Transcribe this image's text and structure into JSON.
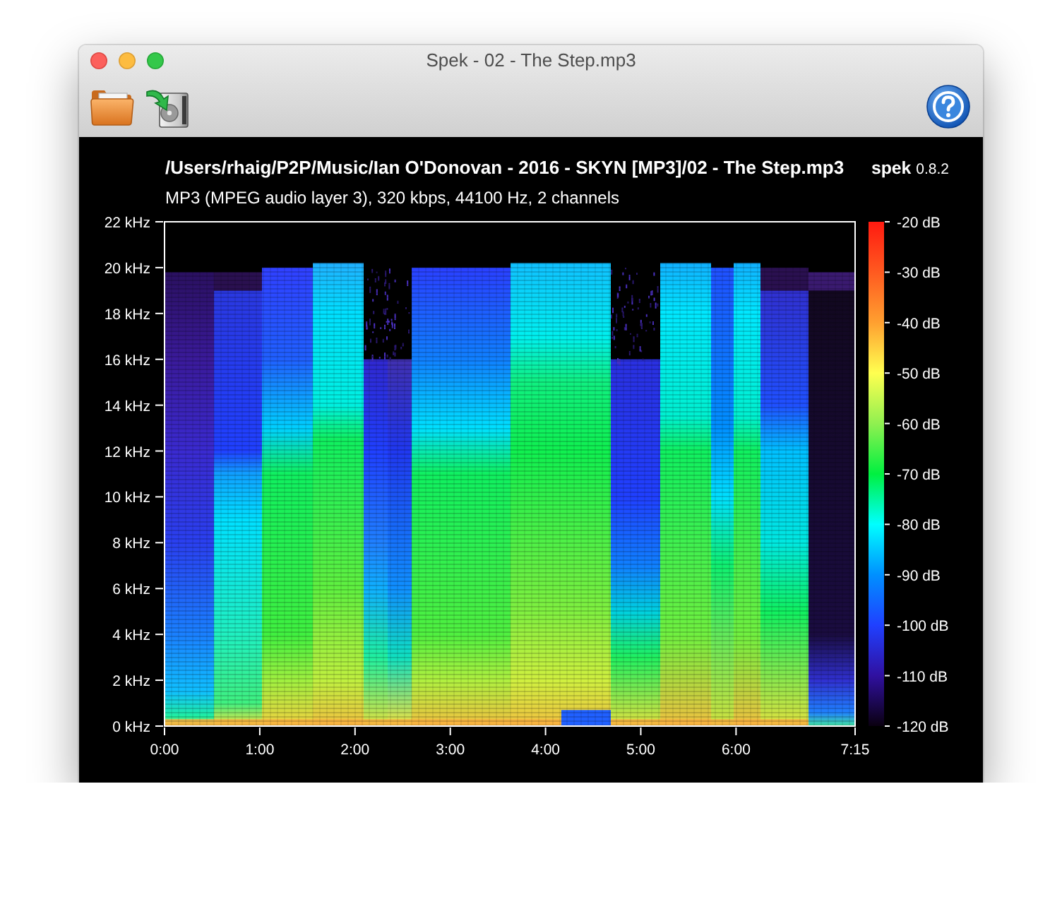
{
  "window": {
    "title": "Spek - 02 - The Step.mp3"
  },
  "header": {
    "file_path": "/Users/rhaig/P2P/Music/Ian O'Donovan - 2016 - SKYN [MP3]/02 - The Step.mp3",
    "app_name": "spek",
    "app_version": "0.8.2",
    "file_info": "MP3 (MPEG audio layer 3), 320 kbps, 44100 Hz, 2 channels"
  },
  "spectrogram": {
    "frequency_ticks": [
      "22 kHz",
      "20 kHz",
      "18 kHz",
      "16 kHz",
      "14 kHz",
      "12 kHz",
      "10 kHz",
      "8 kHz",
      "6 kHz",
      "4 kHz",
      "2 kHz",
      "0 kHz"
    ],
    "time_ticks": [
      "0:00",
      "1:00",
      "2:00",
      "3:00",
      "4:00",
      "5:00",
      "6:00",
      "7:15"
    ]
  },
  "color_scale": {
    "ticks": [
      "-20 dB",
      "-30 dB",
      "-40 dB",
      "-50 dB",
      "-60 dB",
      "-70 dB",
      "-80 dB",
      "-90 dB",
      "-100 dB",
      "-110 dB",
      "-120 dB"
    ]
  }
}
